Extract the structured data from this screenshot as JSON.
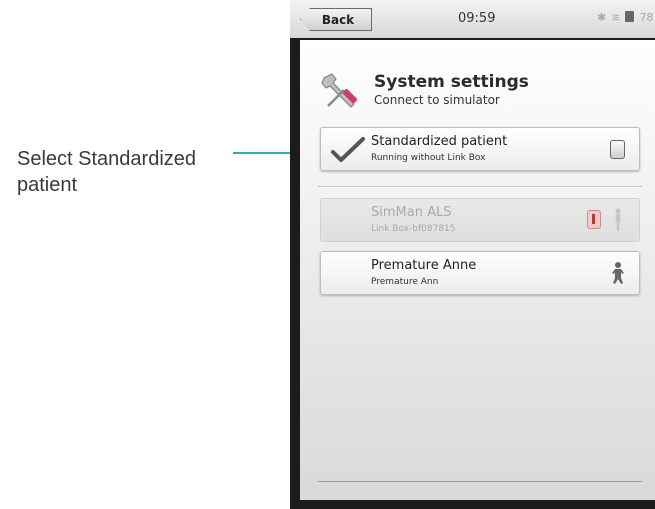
{
  "annotation": {
    "text": "Select Standardized patient",
    "accent_color": "#29b3ad"
  },
  "statusbar": {
    "back_label": "Back",
    "time": "09:59",
    "battery_text": "78"
  },
  "header": {
    "title": "System settings",
    "subtitle": "Connect to simulator",
    "icon": "tools-icon"
  },
  "simulators": [
    {
      "title": "Standardized patient",
      "subtitle": "Running without Link Box",
      "selected": true,
      "enabled": true,
      "icon": "device-icon"
    },
    {
      "title": "SimMan ALS",
      "subtitle": "Link Box-bf087815",
      "selected": false,
      "enabled": false,
      "icon": "figure-icon"
    },
    {
      "title": "Premature Anne",
      "subtitle": "Premature Ann",
      "selected": false,
      "enabled": true,
      "icon": "baby-figure-icon"
    }
  ]
}
